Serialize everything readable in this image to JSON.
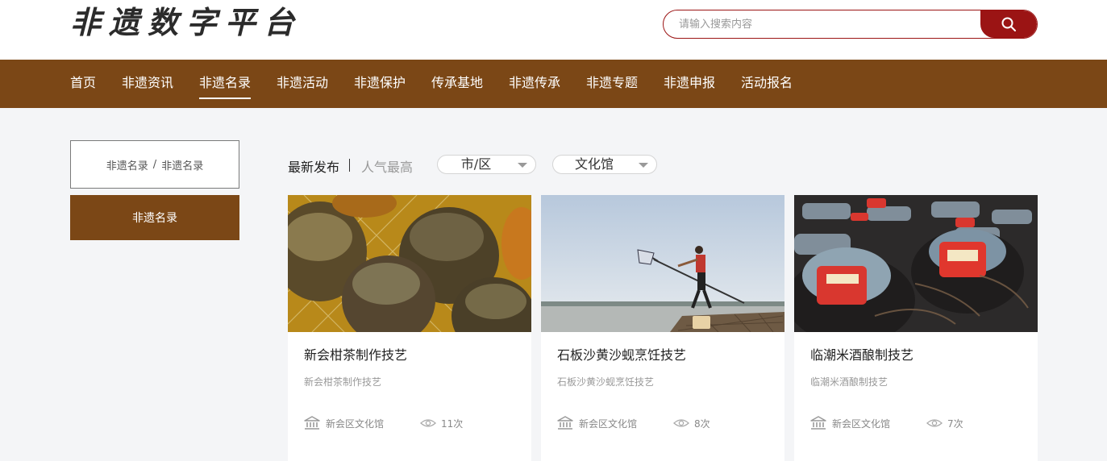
{
  "header": {
    "logo_text": "非遗数字平台",
    "search_placeholder": "请输入搜索内容",
    "search_icon": "search-icon"
  },
  "nav": {
    "items": [
      "首页",
      "非遗资讯",
      "非遗名录",
      "非遗活动",
      "非遗保护",
      "传承基地",
      "非遗传承",
      "非遗专题",
      "非遗申报",
      "活动报名"
    ],
    "active": "非遗名录"
  },
  "sidebar": {
    "breadcrumb": [
      "非遗名录",
      "非遗名录"
    ],
    "breadcrumb_separator": "/",
    "menu_item": "非遗名录"
  },
  "filters": {
    "sort_latest": "最新发布",
    "sort_popular": "人气最高",
    "city_select": "市/区",
    "venue_select": "文化馆"
  },
  "cards": [
    {
      "title": "新会柑茶制作技艺",
      "desc": "新会柑茶制作技艺",
      "venue": "新会区文化馆",
      "views": "11次",
      "image": "dried-citrus-tea-photo"
    },
    {
      "title": "石板沙黄沙蚬烹饪技艺",
      "desc": "石板沙黄沙蚬烹饪技艺",
      "venue": "新会区文化馆",
      "views": "8次",
      "image": "clam-fishing-net-photo"
    },
    {
      "title": "临潮米酒酿制技艺",
      "desc": "临潮米酒酿制技艺",
      "venue": "新会区文化馆",
      "views": "7次",
      "image": "rice-wine-jars-photo"
    }
  ],
  "icons": {
    "venue": "museum-icon",
    "views": "eye-icon"
  },
  "colors": {
    "brand_brown": "#7b4716",
    "search_red": "#9b1414",
    "page_bg": "#f4f5f7"
  }
}
